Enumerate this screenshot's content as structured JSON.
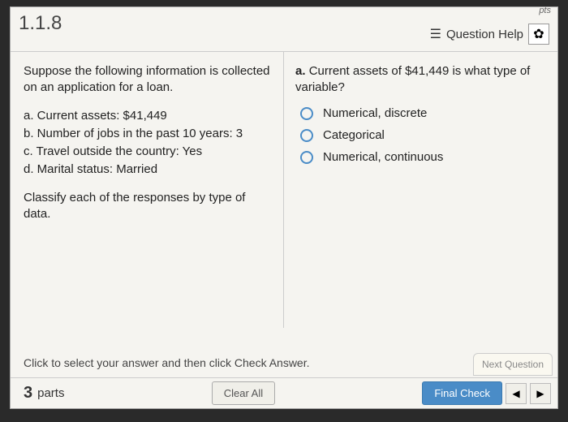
{
  "header": {
    "question_number": "1.1.8",
    "pts_text": "pts",
    "help_label": "Question Help"
  },
  "left": {
    "intro": "Suppose the following information is collected on an application for a loan.",
    "items": {
      "a": "a. Current assets: $41,449",
      "b": "b. Number of jobs in the past 10 years: 3",
      "c": "c. Travel outside the country: Yes",
      "d": "d. Marital status: Married"
    },
    "task": "Classify each of the responses by type of data."
  },
  "right": {
    "prompt_label": "a.",
    "prompt_text": "Current assets of $41,449 is what type of variable?",
    "options": {
      "o1": "Numerical, discrete",
      "o2": "Categorical",
      "o3": "Numerical, continuous"
    }
  },
  "footer": {
    "instruction": "Click to select your answer and then click Check Answer.",
    "parts_count": "3",
    "parts_label": "parts",
    "clear_all": "Clear All",
    "final_check": "Final Check",
    "next_question": "Next Question",
    "prev_arrow": "◀",
    "next_arrow": "▶"
  }
}
